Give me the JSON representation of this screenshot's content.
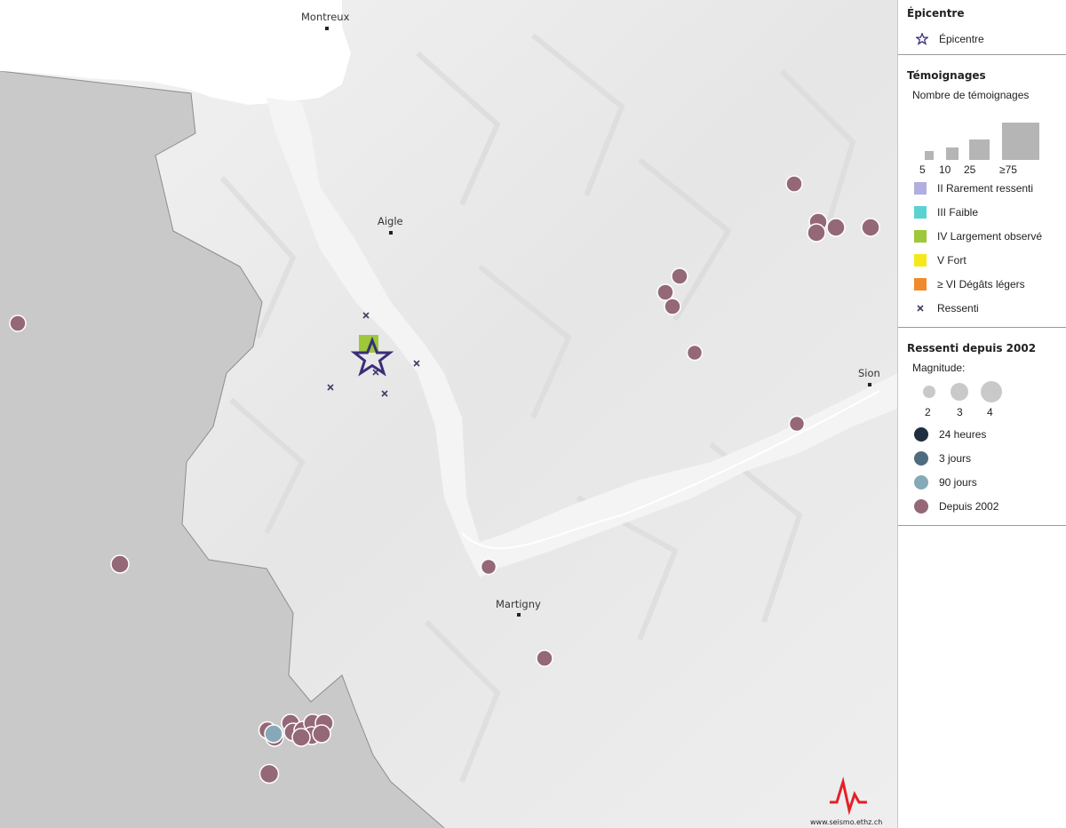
{
  "map": {
    "cities": [
      {
        "name": "Montreux"
      },
      {
        "name": "Aigle"
      },
      {
        "name": "Sion"
      },
      {
        "name": "Martigny"
      }
    ],
    "credit": "www.seismo.ethz.ch",
    "colors": {
      "depuis2002": "#956877",
      "days90": "#86a9b8",
      "felt_marker": "#3d3d66",
      "epicentre": "#3a2e7a",
      "intensity_iv": "#9cc83a"
    }
  },
  "legend": {
    "epicentre": {
      "title": "Épicentre",
      "item": "Épicentre"
    },
    "temoignages": {
      "title": "Témoignages",
      "subtitle": "Nombre de témoignages",
      "size_labels": [
        "5",
        "10",
        "25",
        "≥75"
      ],
      "items": [
        {
          "label": "II Rarement ressenti",
          "color": "#b1aee0"
        },
        {
          "label": "III Faible",
          "color": "#5ad2d2"
        },
        {
          "label": "IV Largement observé",
          "color": "#9cc83a"
        },
        {
          "label": "V Fort",
          "color": "#f5e81a"
        },
        {
          "label": "≥ VI Dégâts légers",
          "color": "#f08a2a"
        },
        {
          "label": "Ressenti",
          "icon": "cross-icon"
        }
      ]
    },
    "ressenti": {
      "title": "Ressenti depuis 2002",
      "subtitle": "Magnitude:",
      "mag_labels": [
        "2",
        "3",
        "4"
      ],
      "items": [
        {
          "label": "24 heures",
          "color": "#1f2f3f"
        },
        {
          "label": "3 jours",
          "color": "#4f6b80"
        },
        {
          "label": "90 jours",
          "color": "#86a9b8"
        },
        {
          "label": "Depuis 2002",
          "color": "#956877"
        }
      ]
    }
  }
}
